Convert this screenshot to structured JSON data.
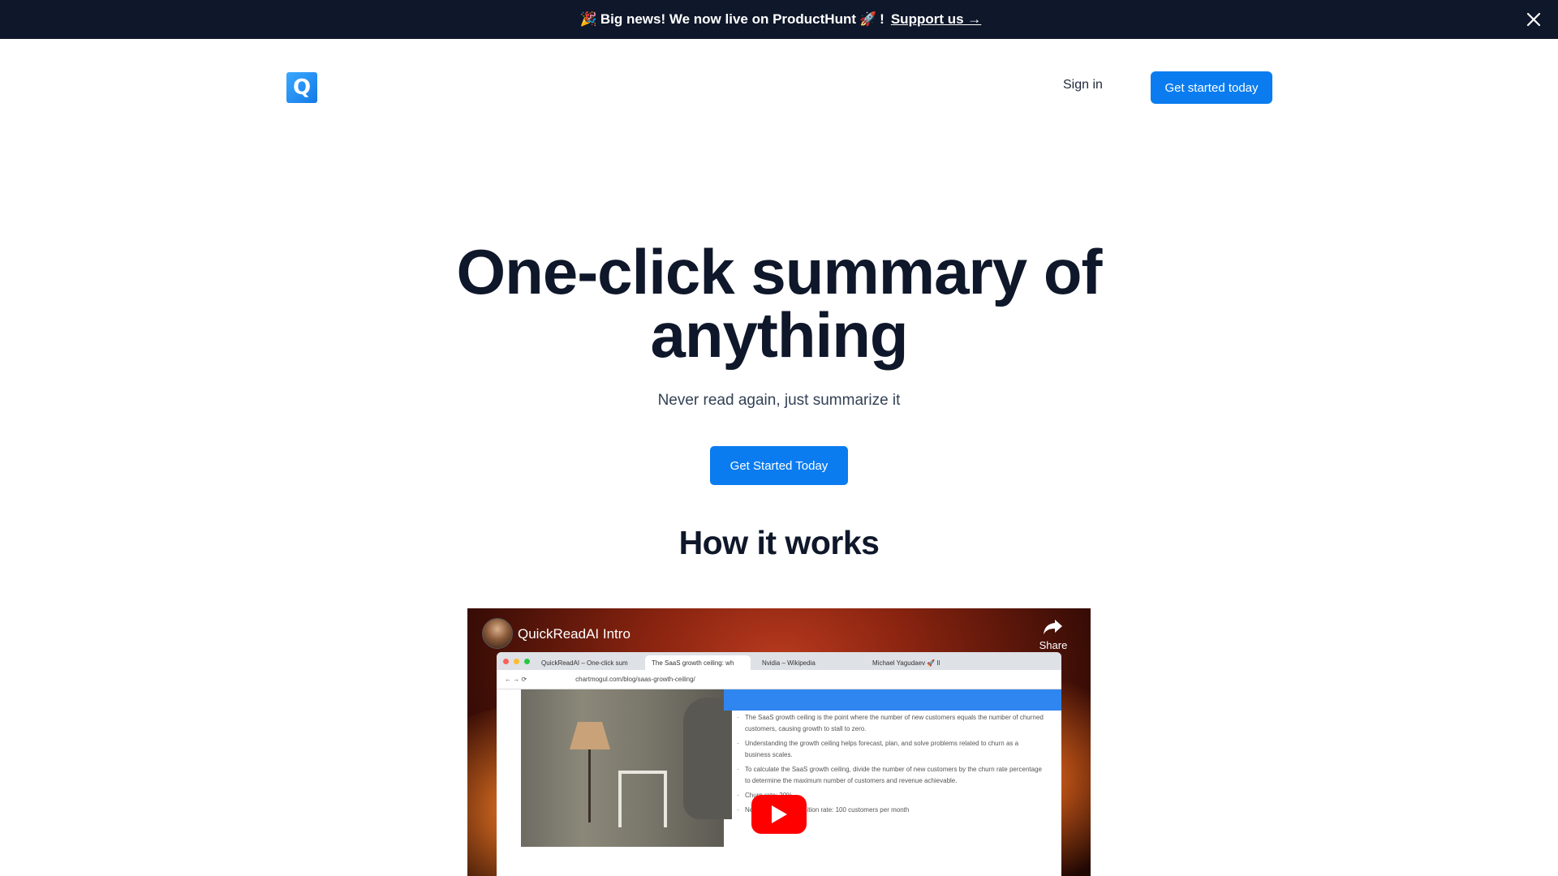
{
  "announcement": {
    "party_emoji": "🎉",
    "text": "Big news! We now live on ProductHunt",
    "rocket_emoji": "🚀",
    "exclaim": "!",
    "link_label": "Support us →"
  },
  "header": {
    "logo_letter": "Q",
    "signin_label": "Sign in",
    "cta_label": "Get started today"
  },
  "hero": {
    "title_line1": "One-click summary of",
    "title_line2": "anything",
    "subtitle": "Never read again, just summarize it",
    "cta_label": "Get Started Today"
  },
  "how_it_works": {
    "heading": "How it works"
  },
  "video": {
    "title": "QuickReadAI Intro",
    "share_label": "Share",
    "browser": {
      "tabs": [
        "QuickReadAI – One-click sum",
        "The SaaS growth ceiling: wh",
        "Nvidia – Wikipedia",
        "Michael Yagudaev 🚀 Il"
      ],
      "url": "chartmogul.com/blog/saas-growth-ceiling/",
      "summary_lines": [
        "The SaaS growth ceiling is the point where the number of new customers equals the number of churned customers, causing growth to stall to zero.",
        "Understanding the growth ceiling helps forecast, plan, and solve problems related to churn as a business scales.",
        "To calculate the SaaS growth ceiling, divide the number of new customers by the churn rate percentage to determine the maximum number of customers and revenue achievable.",
        "Churn rate: 20%",
        "New customer acquisition rate: 100 customers per month"
      ]
    }
  },
  "colors": {
    "announcement_bg": "#0f172a",
    "primary": "#0a7cf0",
    "heading": "#0f172a"
  }
}
